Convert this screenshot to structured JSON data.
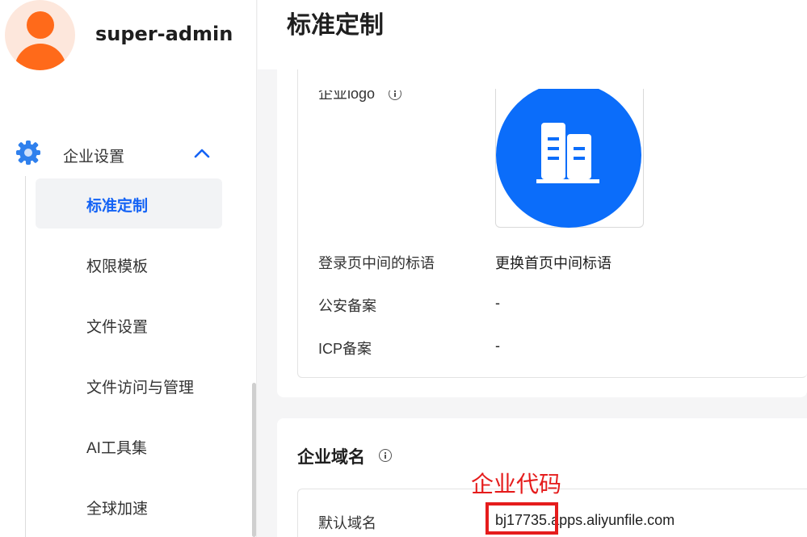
{
  "user": {
    "name": "super-admin"
  },
  "sidebar": {
    "group": {
      "label": "企业设置",
      "icon": "gear-icon",
      "expanded": true
    },
    "items": [
      {
        "label": "标准定制",
        "active": true
      },
      {
        "label": "权限模板",
        "active": false
      },
      {
        "label": "文件设置",
        "active": false
      },
      {
        "label": "文件访问与管理",
        "active": false
      },
      {
        "label": "AI工具集",
        "active": false
      },
      {
        "label": "全球加速",
        "active": false
      }
    ]
  },
  "page": {
    "title": "标准定制"
  },
  "branding": {
    "logo_label": "企业logo",
    "rows": [
      {
        "label": "登录页中间的标语",
        "value": "更换首页中间标语"
      },
      {
        "label": "公安备案",
        "value": "-"
      },
      {
        "label": "ICP备案",
        "value": "-"
      }
    ]
  },
  "domain": {
    "title": "企业域名",
    "default_label": "默认域名",
    "code": "bj17735",
    "suffix": ".apps.aliyunfile.com"
  },
  "annotation": {
    "text": "企业代码"
  },
  "colors": {
    "accent": "#1463f5",
    "logo_bg": "#0b6dfa",
    "annotation": "#e51c1c"
  }
}
